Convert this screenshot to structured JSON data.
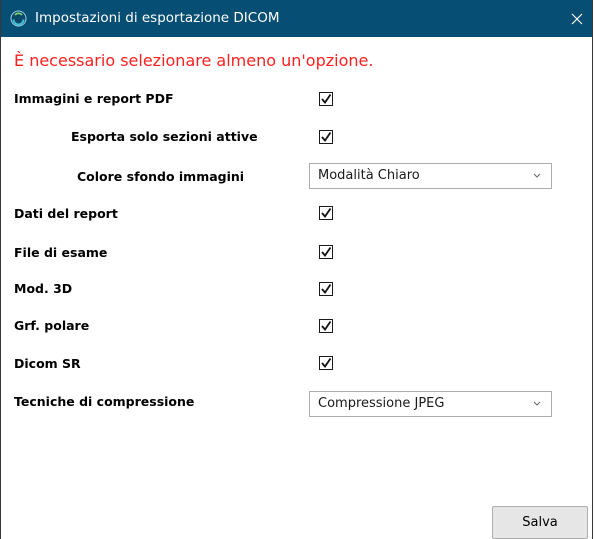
{
  "window": {
    "title": "Impostazioni di esportazione DICOM",
    "close_glyph": "✕"
  },
  "error_message": "È necessario selezionare almeno un'opzione.",
  "options": [
    {
      "label": "Immagini e report PDF",
      "checked": true
    },
    {
      "label": "Esporta solo sezioni attive",
      "checked": true
    },
    {
      "label": "Dati del report",
      "checked": true
    },
    {
      "label": "File di esame",
      "checked": true
    },
    {
      "label": "Mod. 3D",
      "checked": true
    },
    {
      "label": "Grf. polare",
      "checked": true
    },
    {
      "label": "Dicom SR",
      "checked": true
    }
  ],
  "background_color": {
    "label": "Colore sfondo immagini",
    "selected": "Modalità Chiaro"
  },
  "compression": {
    "label": "Tecniche di compressione",
    "selected": "Compressione JPEG"
  },
  "buttons": {
    "save": "Salva"
  },
  "colors": {
    "titlebar": "#064e73",
    "error": "#ff2020"
  },
  "icons": {
    "app": "app-logo-icon",
    "close": "close-icon",
    "checkmark": "checkmark-icon",
    "dropdown": "chevron-down-icon"
  }
}
